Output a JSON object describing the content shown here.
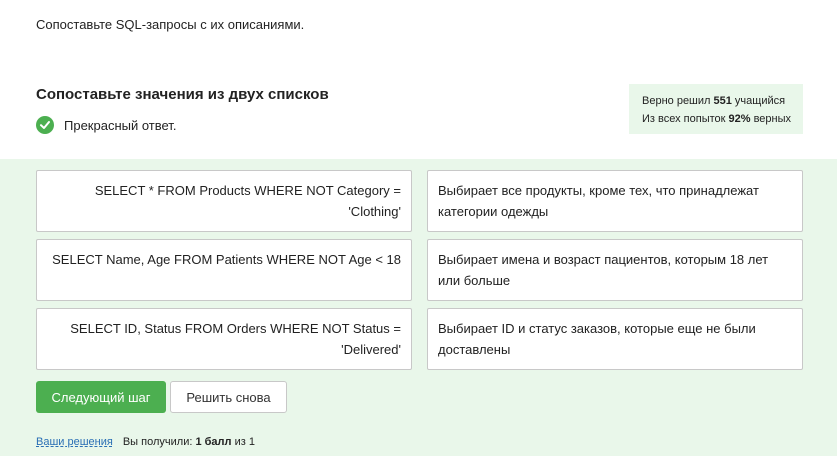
{
  "prompt": "Сопоставьте SQL-запросы с их описаниями.",
  "task": {
    "heading": "Сопоставьте значения из двух списков",
    "feedback": "Прекрасный ответ."
  },
  "stats": {
    "line1_prefix": "Верно решил ",
    "solved_count": "551",
    "line1_suffix": " учащийся",
    "line2_prefix": "Из всех попыток ",
    "percent": "92%",
    "line2_suffix": " верных"
  },
  "pairs": [
    {
      "query": "SELECT * FROM Products WHERE NOT Category = 'Clothing'",
      "description": "Выбирает все продукты, кроме тех, что принадлежат категории одежды"
    },
    {
      "query": "SELECT Name, Age FROM Patients WHERE NOT Age < 18",
      "description": "Выбирает имена и возраст пациентов, которым 18 лет или больше"
    },
    {
      "query": "SELECT ID, Status FROM Orders WHERE NOT Status = 'Delivered'",
      "description": "Выбирает ID и статус заказов, которые еще не были доставлены"
    }
  ],
  "buttons": {
    "next": "Следующий шаг",
    "retry": "Решить снова"
  },
  "footer": {
    "solutions_link": "Ваши решения",
    "score_prefix": "Вы получили: ",
    "score_value": "1 балл",
    "score_suffix": " из 1"
  },
  "colors": {
    "accent_green": "#4caf50",
    "panel_bg": "#e9f7ea",
    "link": "#2a6fb5"
  }
}
